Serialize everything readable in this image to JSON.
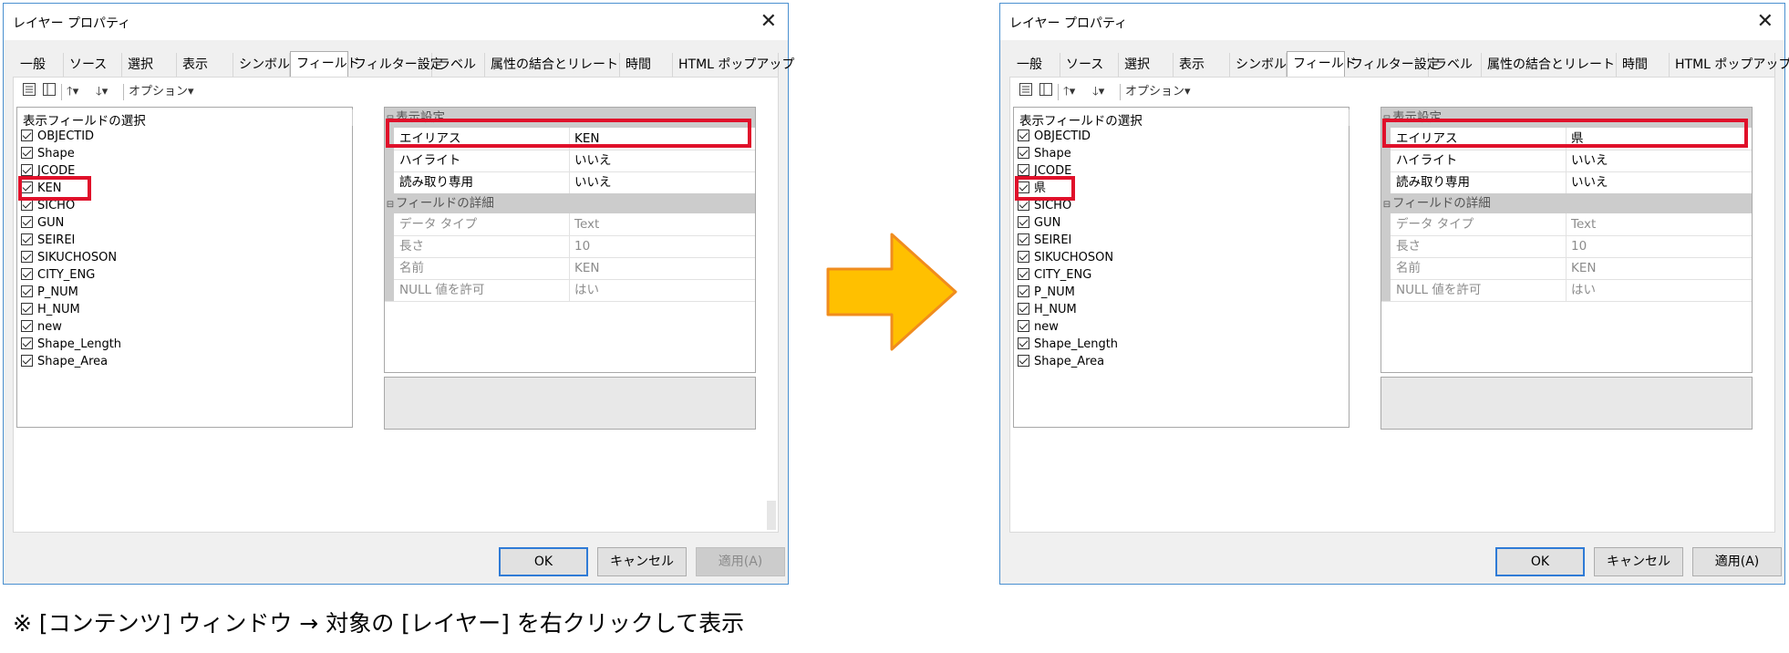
{
  "dialog": {
    "title": "レイヤー プロパティ",
    "close_glyph": "✕",
    "tabs": [
      "一般",
      "ソース",
      "選択",
      "表示",
      "シンボル",
      "フィールド",
      "フィルター設定",
      "ラベル",
      "属性の結合とリレート",
      "時間",
      "HTML ポップアップ"
    ],
    "active_tab": "フィールド",
    "toolbar": {
      "up_label": "🡑▾",
      "down_label": "🡓▾",
      "options_label": "オプション▾"
    },
    "field_list_header": "表示フィールドの選択",
    "buttons": {
      "ok": "OK",
      "cancel": "キャンセル",
      "apply": "適用(A)"
    },
    "property_grid": {
      "display_settings": "表示設定",
      "alias_label": "エイリアス",
      "highlight_label": "ハイライト",
      "readonly_label": "読み取り専用",
      "field_details": "フィールドの詳細",
      "datatype_label": "データ タイプ",
      "length_label": "長さ",
      "name_label": "名前",
      "nullable_label": "NULL 値を許可",
      "highlight_value": "いいえ",
      "readonly_value": "いいえ",
      "datatype_value": "Text",
      "length_value": "10",
      "name_value": "KEN",
      "nullable_value": "はい"
    }
  },
  "before": {
    "fields": [
      "OBJECTID",
      "Shape",
      "JCODE",
      "KEN",
      "SICHO",
      "GUN",
      "SEIREI",
      "SIKUCHOSON",
      "CITY_ENG",
      "P_NUM",
      "H_NUM",
      "new",
      "Shape_Length",
      "Shape_Area"
    ],
    "alias_value": "KEN",
    "apply_enabled": false
  },
  "after": {
    "fields": [
      "OBJECTID",
      "Shape",
      "JCODE",
      "県",
      "SICHO",
      "GUN",
      "SEIREI",
      "SIKUCHOSON",
      "CITY_ENG",
      "P_NUM",
      "H_NUM",
      "new",
      "Shape_Length",
      "Shape_Area"
    ],
    "alias_value": "県",
    "apply_enabled": true
  },
  "arrow_color": "#ffc000",
  "highlight_color": "#e0102a",
  "note": "※ [コンテンツ] ウィンドウ → 対象の [レイヤー] を右クリックして表示"
}
